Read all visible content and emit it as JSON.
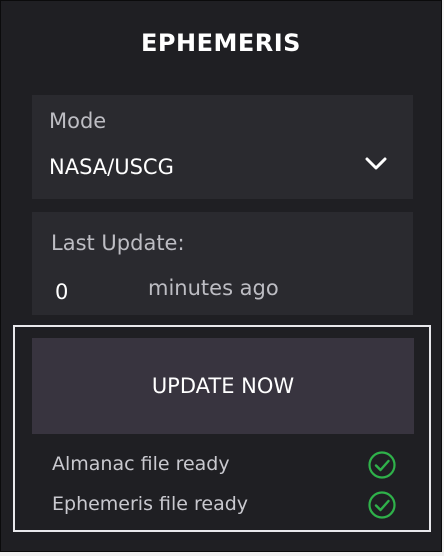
{
  "panel": {
    "title": "EPHEMERIS"
  },
  "mode": {
    "label": "Mode",
    "value": "NASA/USCG",
    "dropdown_icon": "chevron-down-icon"
  },
  "last_update": {
    "label": "Last Update:",
    "minutes": "0",
    "suffix": "minutes ago"
  },
  "actions": {
    "update_label": "UPDATE NOW"
  },
  "status": {
    "items": [
      {
        "label": "Almanac file ready",
        "icon": "check-circle-icon"
      },
      {
        "label": "Ephemeris file ready",
        "icon": "check-circle-icon"
      }
    ]
  },
  "colors": {
    "panel_background": "#1f1f23",
    "card_background": "#2a2a2f",
    "button_background": "#38343f",
    "status_ok": "#2fb14a",
    "frame_border": "#e8e8ec"
  }
}
